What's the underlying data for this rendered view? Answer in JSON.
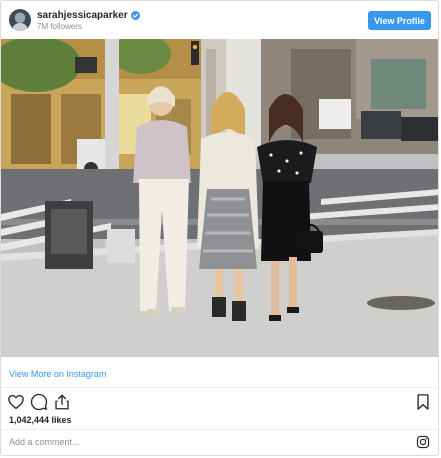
{
  "header": {
    "username": "sarahjessicaparker",
    "followers": "7M followers",
    "view_profile_label": "View Profile",
    "verified_icon": "verified-badge-icon"
  },
  "post": {
    "image_alt": "Three women walking across a New York City street",
    "view_more_label": "View More on Instagram",
    "likes": "1,042,444 likes",
    "comment_placeholder": "Add a comment..."
  },
  "icons": {
    "like": "heart-icon",
    "comment": "comment-icon",
    "share": "share-icon",
    "save": "bookmark-icon",
    "logo": "instagram-logo-icon"
  },
  "colors": {
    "accent": "#3897f0",
    "text": "#262626",
    "muted": "#8e8e8e",
    "border": "#dbdbdb"
  }
}
